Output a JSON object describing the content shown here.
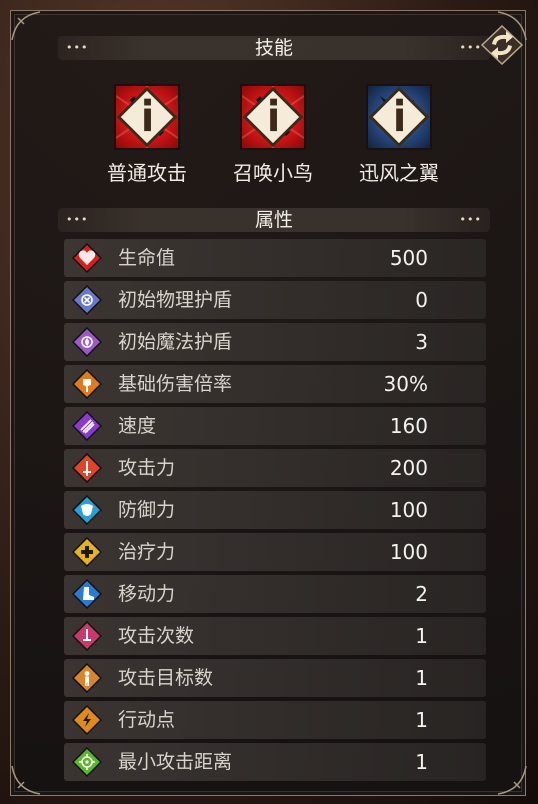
{
  "skills_section": {
    "title": "技能",
    "dots": "•••"
  },
  "skills": [
    {
      "label": "普通攻击",
      "color": "red",
      "icon": "sword-icon"
    },
    {
      "label": "召唤小鸟",
      "color": "red",
      "icon": "sword-icon"
    },
    {
      "label": "迅风之翼",
      "color": "blue",
      "icon": "wing-icon"
    }
  ],
  "attributes_section": {
    "title": "属性",
    "dots": "•••"
  },
  "attributes": [
    {
      "name": "生命值",
      "value": "500",
      "icon": "heart-icon",
      "color": "#d81e1e"
    },
    {
      "name": "初始物理护盾",
      "value": "0",
      "icon": "physical-shield-icon",
      "color": "#6a78c8"
    },
    {
      "name": "初始魔法护盾",
      "value": "3",
      "icon": "magic-shield-icon",
      "color": "#9a5ac8"
    },
    {
      "name": "基础伤害倍率",
      "value": "30%",
      "icon": "axe-icon",
      "color": "#e07a1a"
    },
    {
      "name": "速度",
      "value": "160",
      "icon": "speed-icon",
      "color": "#8a3ad0"
    },
    {
      "name": "攻击力",
      "value": "200",
      "icon": "attack-icon",
      "color": "#e0442a"
    },
    {
      "name": "防御力",
      "value": "100",
      "icon": "defense-icon",
      "color": "#2aa0d8"
    },
    {
      "name": "治疗力",
      "value": "100",
      "icon": "heal-icon",
      "color": "#e8b21a"
    },
    {
      "name": "移动力",
      "value": "2",
      "icon": "boot-icon",
      "color": "#2a7ad8"
    },
    {
      "name": "攻击次数",
      "value": "1",
      "icon": "attack-count-icon",
      "color": "#c83a6a"
    },
    {
      "name": "攻击目标数",
      "value": "1",
      "icon": "target-person-icon",
      "color": "#d8862a"
    },
    {
      "name": "行动点",
      "value": "1",
      "icon": "lightning-icon",
      "color": "#e08a1a"
    },
    {
      "name": "最小攻击距离",
      "value": "1",
      "icon": "crosshair-icon",
      "color": "#5ab82a"
    }
  ]
}
